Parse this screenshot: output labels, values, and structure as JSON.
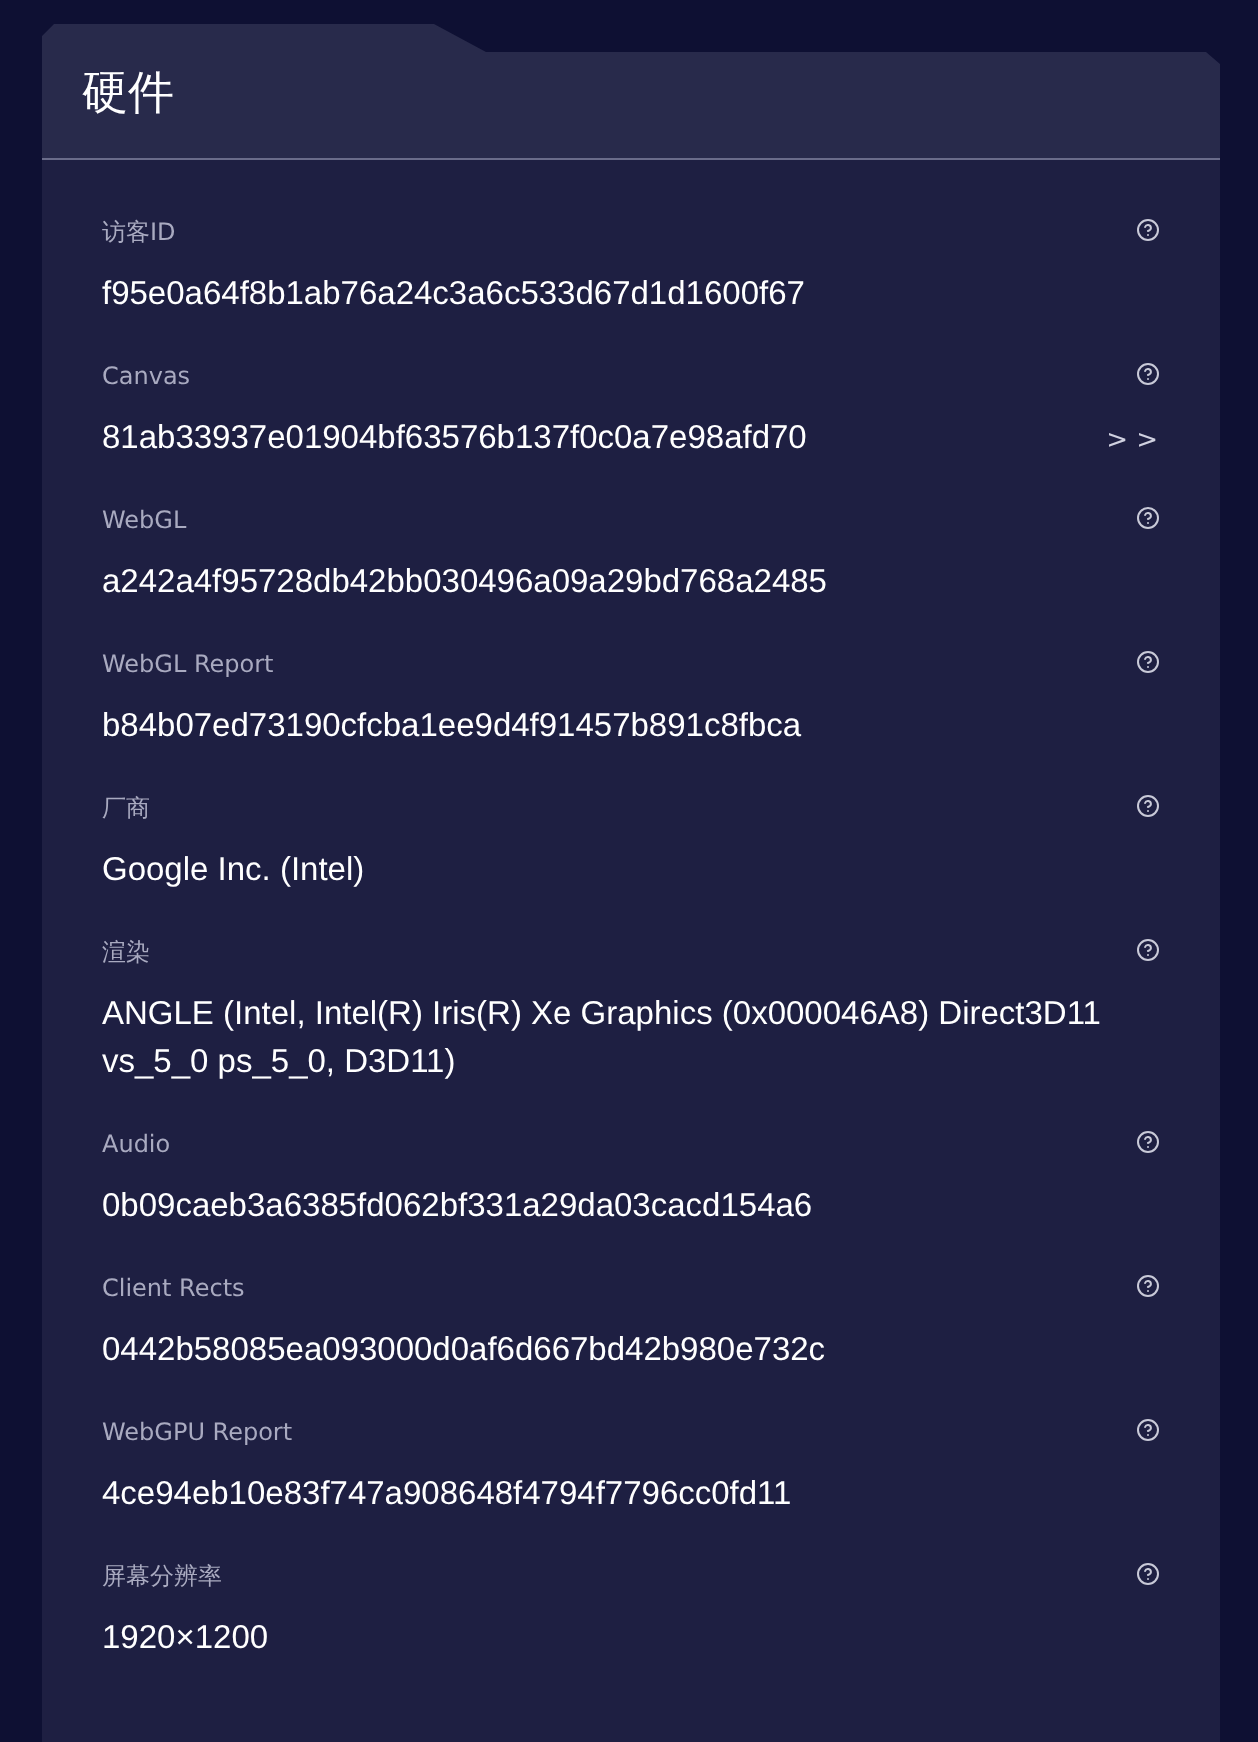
{
  "panel": {
    "title": "硬件"
  },
  "items": [
    {
      "label": "访客ID",
      "value": "f95e0a64f8b1ab76a24c3a6c533d67d1d1600f67"
    },
    {
      "label": "Canvas",
      "value": "81ab33937e01904bf63576b137f0c0a7e98afd70",
      "action": "> >"
    },
    {
      "label": "WebGL",
      "value": "a242a4f95728db42bb030496a09a29bd768a2485"
    },
    {
      "label": "WebGL Report",
      "value": "b84b07ed73190cfcba1ee9d4f91457b891c8fbca"
    },
    {
      "label": "厂商",
      "value": "Google Inc. (Intel)"
    },
    {
      "label": "渲染",
      "value": "ANGLE (Intel, Intel(R) Iris(R) Xe Graphics (0x000046A8) Direct3D11 vs_5_0 ps_5_0, D3D11)"
    },
    {
      "label": "Audio",
      "value": "0b09caeb3a6385fd062bf331a29da03cacd154a6"
    },
    {
      "label": "Client Rects",
      "value": "0442b58085ea093000d0af6d667bd42b980e732c"
    },
    {
      "label": "WebGPU Report",
      "value": "4ce94eb10e83f747a908648f4794f7796cc0fd11"
    },
    {
      "label": "屏幕分辨率",
      "value": "1920×1200"
    }
  ]
}
